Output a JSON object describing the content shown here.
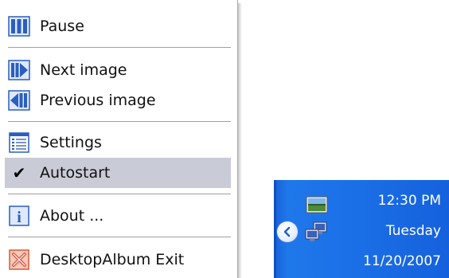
{
  "menu": {
    "items": [
      {
        "label": "Pause",
        "icon": "pause-icon"
      },
      {
        "label": "Next image",
        "icon": "next-image-icon"
      },
      {
        "label": "Previous image",
        "icon": "previous-image-icon"
      },
      {
        "label": "Settings",
        "icon": "settings-icon"
      },
      {
        "label": "Autostart",
        "icon": "checkmark-icon",
        "checked": true,
        "check_glyph": "✔"
      },
      {
        "label": "About ...",
        "icon": "info-icon"
      },
      {
        "label": "DesktopAlbum Exit",
        "icon": "exit-icon"
      }
    ]
  },
  "tray": {
    "time": "12:30 PM",
    "day": "Tuesday",
    "date": "11/20/2007",
    "icons": [
      "desktopalbum-tray-icon",
      "network-icon"
    ],
    "chevron_icon": "show-hidden-icons-chevron"
  },
  "colors": {
    "menu_highlight": "#c9cbd6",
    "taskbar_blue": "#1a6ee6",
    "icon_blue": "#2a5fc0",
    "exit_red": "#e05a4a"
  }
}
